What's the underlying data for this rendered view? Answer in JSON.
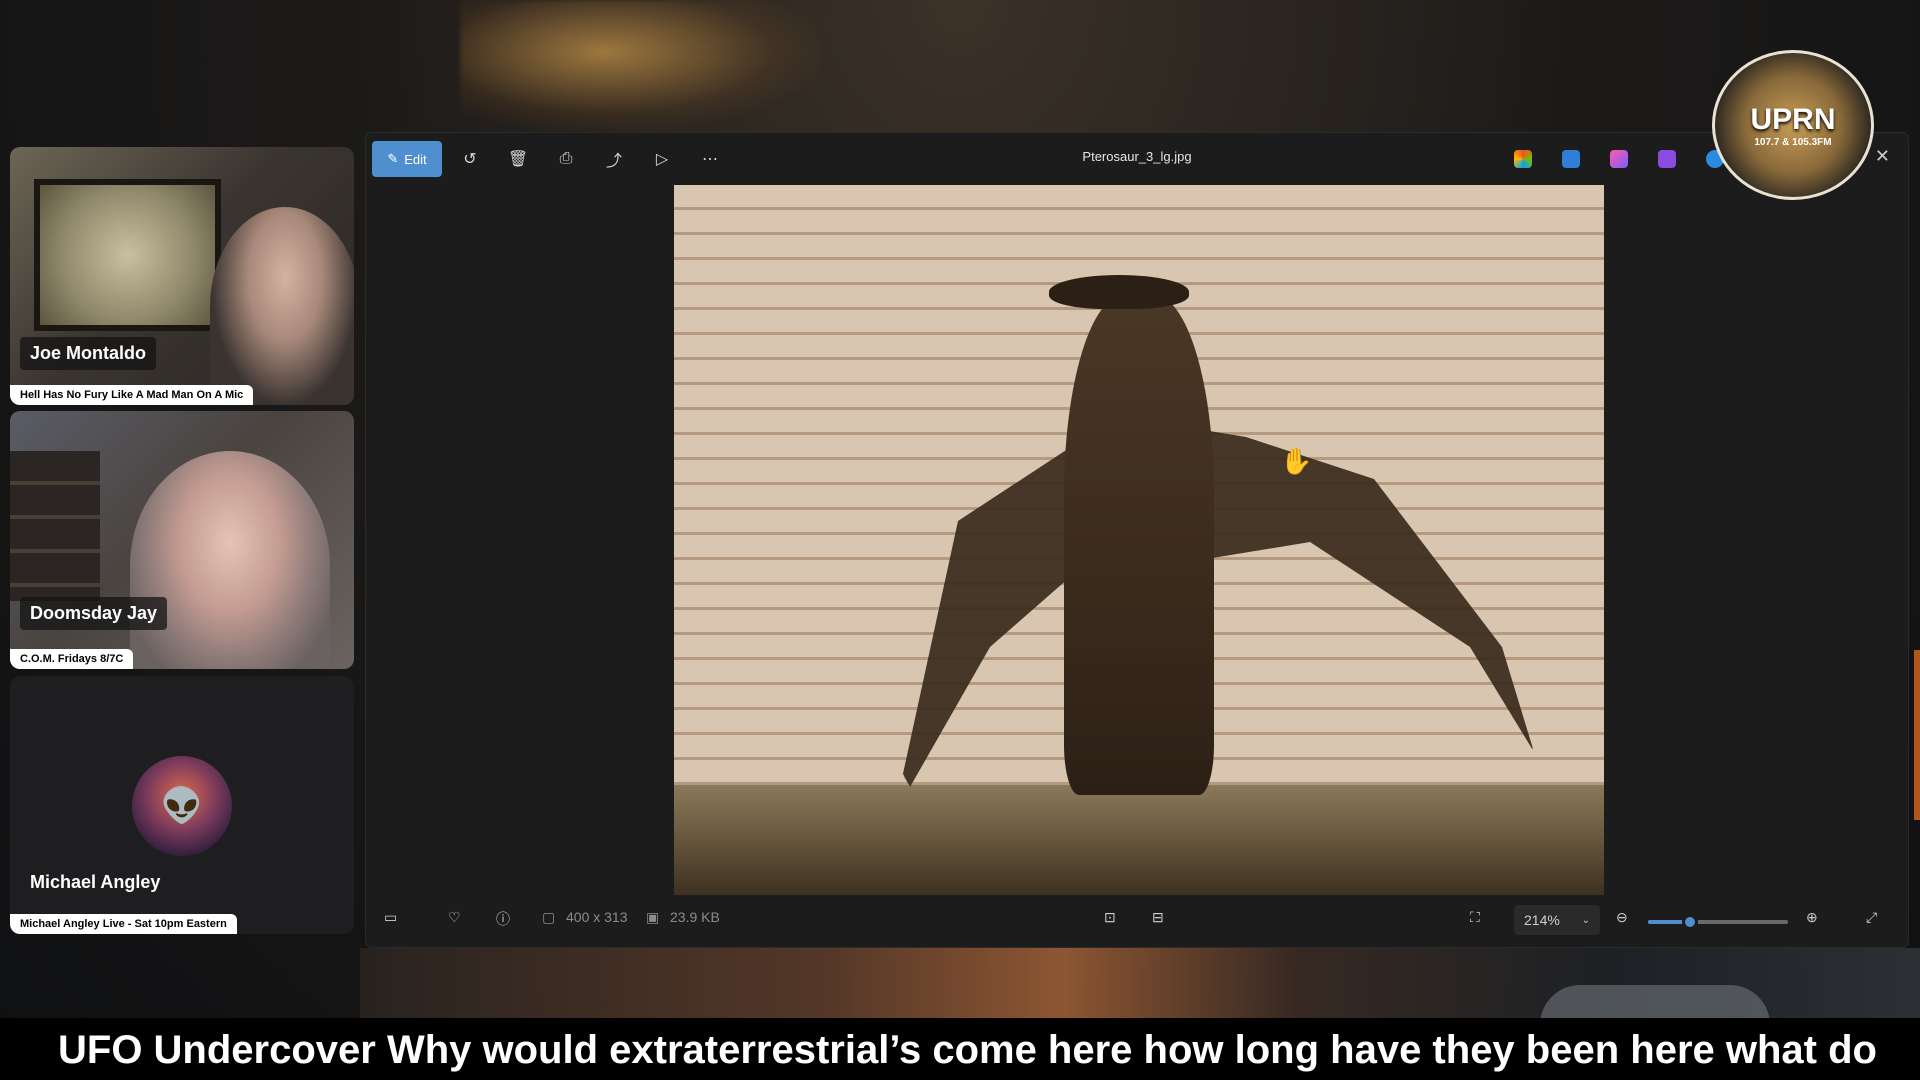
{
  "viewer": {
    "file_name": "Pterosaur_3_lg.jpg",
    "edit_label": "Edit",
    "dimensions": "400 x 313",
    "file_size": "23.9 KB",
    "zoom": "214%",
    "zoom_level_fraction": 0.3,
    "toolbar_icons": [
      "edit-icon",
      "rotate-icon",
      "delete-icon",
      "print-icon",
      "share-icon",
      "slideshow-icon",
      "more-icon"
    ],
    "accent_color": "#4f8fcf"
  },
  "participants": [
    {
      "name": "Joe Montaldo",
      "tagline": "Hell Has No Fury Like A Mad Man On A Mic"
    },
    {
      "name": "Doomsday Jay",
      "tagline": "C.O.M. Fridays 8/7C"
    },
    {
      "name": "Michael Angley",
      "tagline": "Michael Angley Live - Sat 10pm Eastern"
    }
  ],
  "logo": {
    "text": "UPRN",
    "frequency": "107.7 & 105.3FM"
  },
  "ticker": {
    "text": "UFO Undercover Why would extraterrestrial’s come here how long have they been here what do"
  }
}
